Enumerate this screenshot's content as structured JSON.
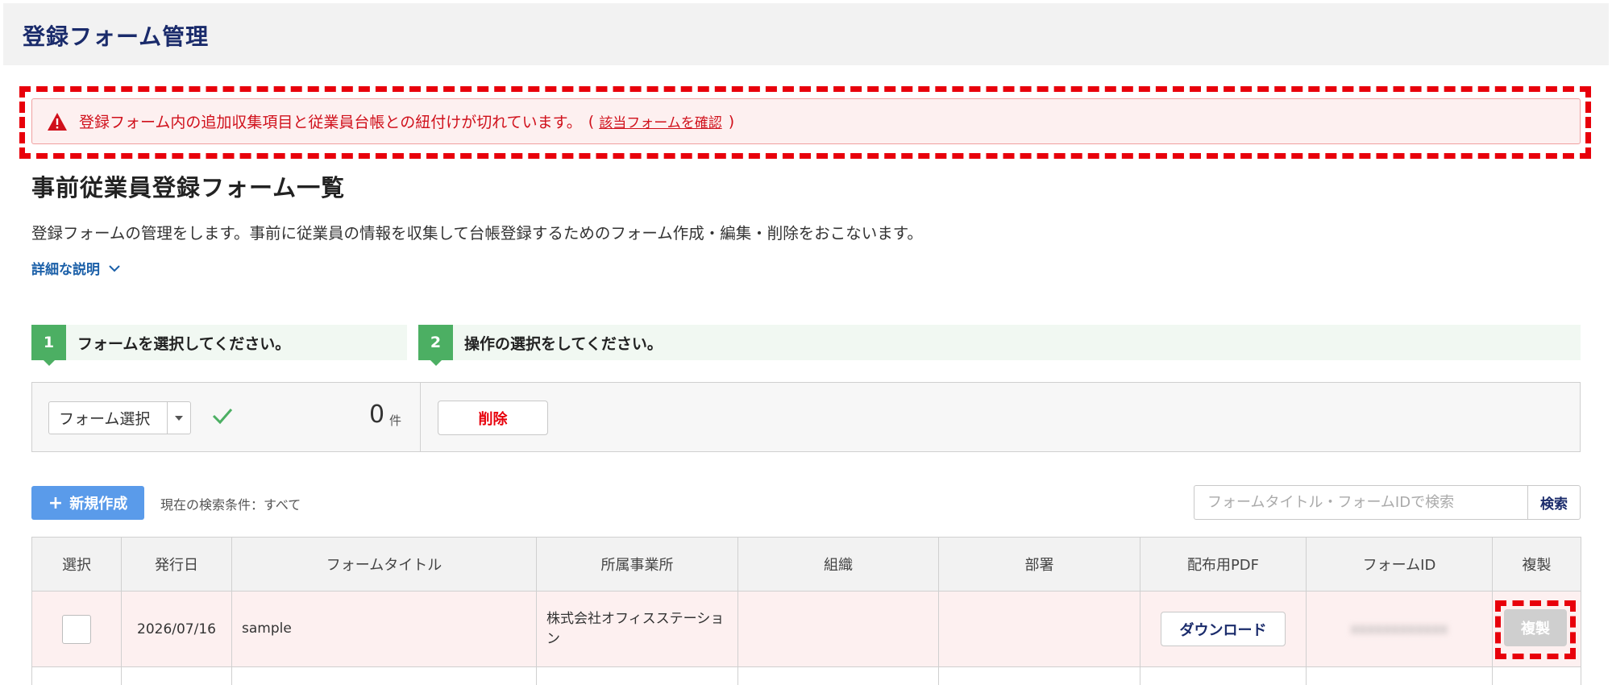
{
  "header": {
    "title": "登録フォーム管理"
  },
  "alert": {
    "message": "登録フォーム内の追加収集項目と従業員台帳との紐付けが切れています。",
    "paren_open": "(",
    "link_label": "該当フォームを確認",
    "paren_close": ")",
    "color": "#d0101b"
  },
  "page": {
    "title": "事前従業員登録フォーム一覧",
    "description": "登録フォームの管理をします。事前に従業員の情報を収集して台帳登録するためのフォーム作成・編集・削除をおこないます。",
    "details_label": "詳細な説明"
  },
  "steps": [
    {
      "number": "1",
      "label": "フォームを選択してください。"
    },
    {
      "number": "2",
      "label": "操作の選択をしてください。"
    }
  ],
  "ops": {
    "form_select_label": "フォーム選択",
    "count": "0",
    "count_unit": "件",
    "delete_label": "削除"
  },
  "toolbar": {
    "new_plus": "+",
    "new_label": "新規作成",
    "search_condition": "現在の検索条件：すべて",
    "search_placeholder": "フォームタイトル・フォームIDで検索",
    "search_button": "検索"
  },
  "table": {
    "headers": [
      "選択",
      "発行日",
      "フォームタイトル",
      "所属事業所",
      "組織",
      "部署",
      "配布用PDF",
      "フォームID",
      "複製"
    ],
    "rows": [
      {
        "date": "2026/07/16",
        "title": "sample",
        "office": "株式会社オフィスステーション",
        "organization": "",
        "department": "",
        "pdf_button": "ダウンロード",
        "form_id": "xxxxxxxxxxxx",
        "copy_button": "複製"
      }
    ]
  },
  "colors": {
    "accent_navy": "#1a2b6b",
    "alert_red": "#e8000b",
    "step_green": "#4caf63",
    "primary_blue": "#5a9bea",
    "row_highlight": "#fdf0f0"
  },
  "icons": {
    "alert": "warning-triangle-icon",
    "details": "chevron-down-icon",
    "select_caret": "caret-down-icon",
    "check": "check-icon",
    "new": "plus-icon"
  }
}
